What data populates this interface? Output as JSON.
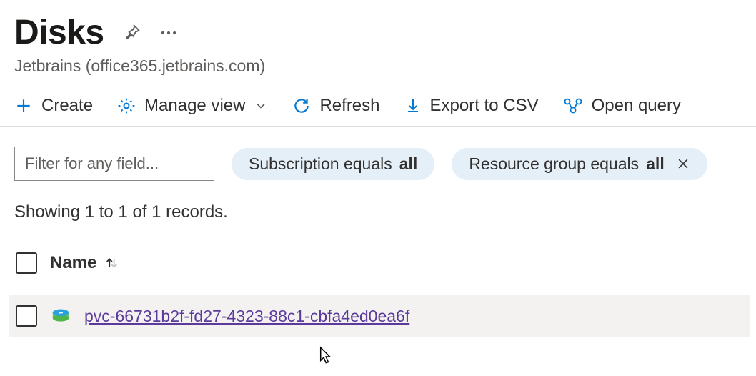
{
  "header": {
    "title": "Disks",
    "subtitle": "Jetbrains (office365.jetbrains.com)"
  },
  "toolbar": {
    "create_label": "Create",
    "manage_view_label": "Manage view",
    "refresh_label": "Refresh",
    "export_label": "Export to CSV",
    "open_query_label": "Open query"
  },
  "filters": {
    "placeholder": "Filter for any field...",
    "pill_subscription_prefix": "Subscription equals ",
    "pill_subscription_value": "all",
    "pill_resourcegroup_prefix": "Resource group equals ",
    "pill_resourcegroup_value": "all"
  },
  "records_count": "Showing 1 to 1 of 1 records.",
  "table": {
    "columns": {
      "name_label": "Name"
    },
    "rows": [
      {
        "name": "pvc-66731b2f-fd27-4323-88c1-cbfa4ed0ea6f"
      }
    ]
  }
}
